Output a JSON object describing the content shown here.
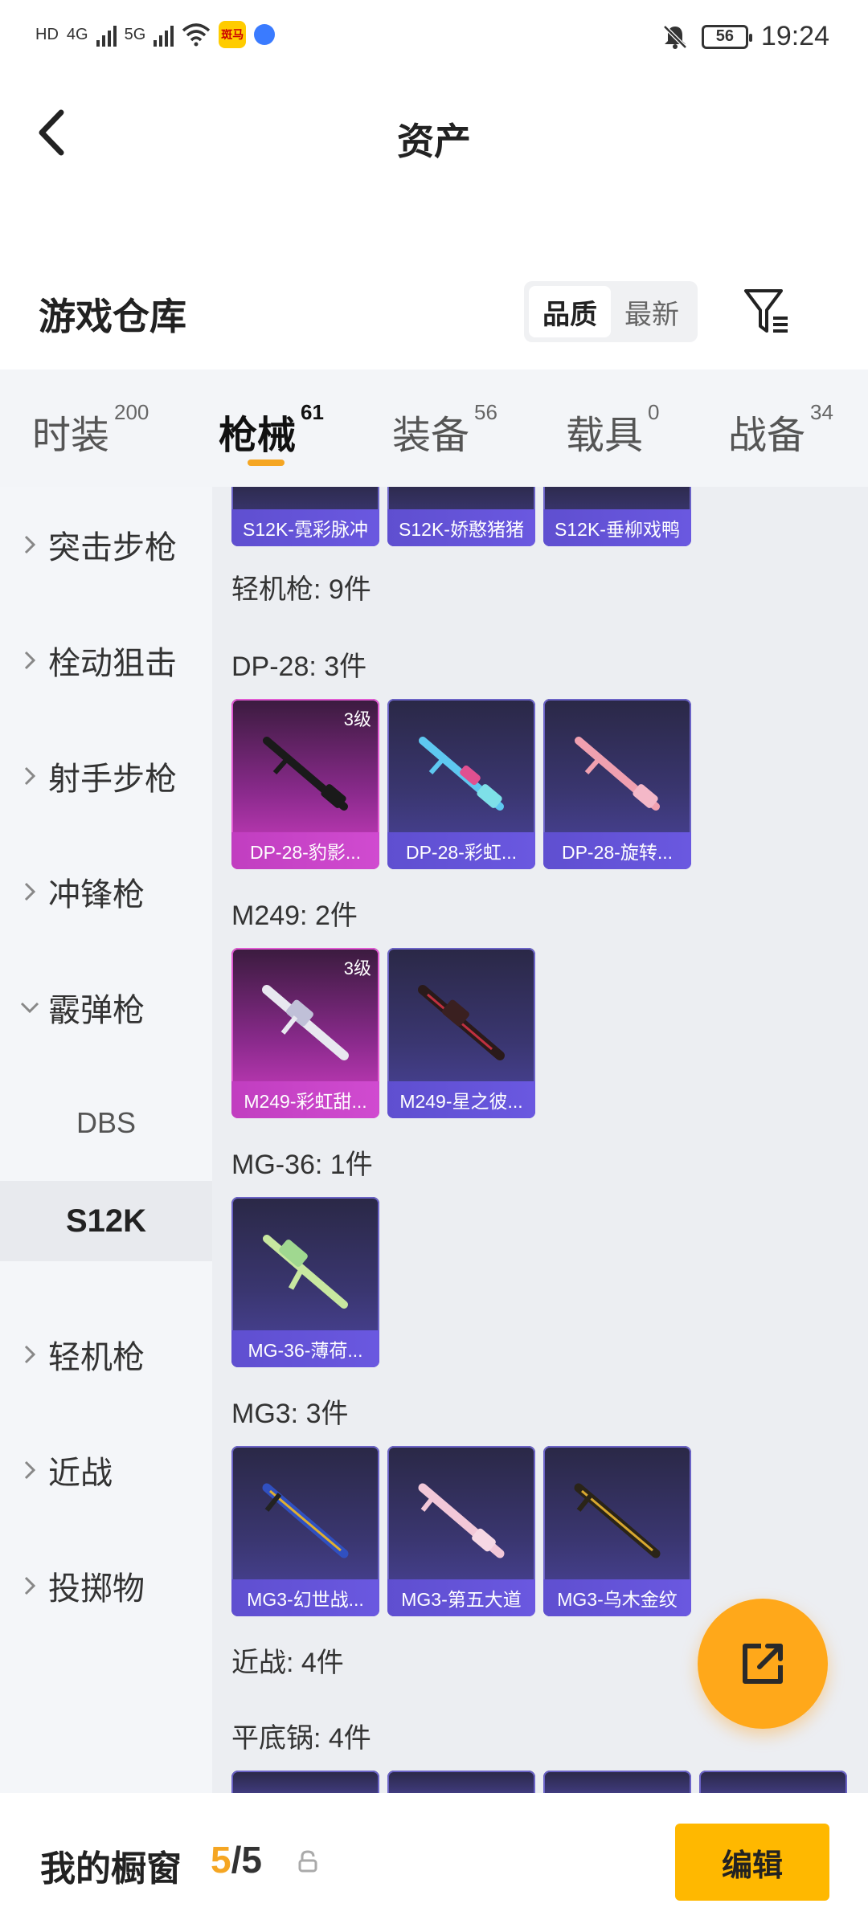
{
  "status_bar": {
    "left_text_1": "HD",
    "left_text_2": "4G",
    "left_text_3": "5G",
    "app_badge": "斑马",
    "battery": "56",
    "time": "19:24"
  },
  "header": {
    "title": "资产"
  },
  "warehouse": {
    "title": "游戏仓库",
    "sort_options": [
      "品质",
      "最新"
    ],
    "selected_sort": "品质"
  },
  "tabs": [
    {
      "label": "时装",
      "count": "200"
    },
    {
      "label": "枪械",
      "count": "61"
    },
    {
      "label": "装备",
      "count": "56"
    },
    {
      "label": "载具",
      "count": "0"
    },
    {
      "label": "战备",
      "count": "34"
    }
  ],
  "active_tab": "枪械",
  "sidebar": {
    "items": [
      {
        "label": "突击步枪"
      },
      {
        "label": "栓动狙击"
      },
      {
        "label": "射手步枪"
      },
      {
        "label": "冲锋枪"
      },
      {
        "label": "霰弹枪"
      }
    ],
    "sub_items": [
      {
        "label": "DBS"
      },
      {
        "label": "S12K"
      }
    ],
    "items_after": [
      {
        "label": "轻机枪"
      },
      {
        "label": "近战"
      },
      {
        "label": "投掷物"
      }
    ]
  },
  "content": {
    "top_cards": [
      "S12K-霓彩脉冲",
      "S12K-娇憨猪猪",
      "S12K-垂柳戏鸭"
    ],
    "category_label": "轻机枪: 9件",
    "groups": [
      {
        "label": "DP-28: 3件",
        "cards": [
          {
            "name": "DP-28-豹影...",
            "level": "3级",
            "rarity": "pink"
          },
          {
            "name": "DP-28-彩虹...",
            "level": "",
            "rarity": "purple"
          },
          {
            "name": "DP-28-旋转...",
            "level": "",
            "rarity": "purple"
          }
        ]
      },
      {
        "label": "M249: 2件",
        "cards": [
          {
            "name": "M249-彩虹甜...",
            "level": "3级",
            "rarity": "pink"
          },
          {
            "name": "M249-星之彼...",
            "level": "",
            "rarity": "purple"
          }
        ]
      },
      {
        "label": "MG-36: 1件",
        "cards": [
          {
            "name": "MG-36-薄荷...",
            "level": "",
            "rarity": "purple"
          }
        ]
      },
      {
        "label": "MG3: 3件",
        "cards": [
          {
            "name": "MG3-幻世战...",
            "level": "",
            "rarity": "purple"
          },
          {
            "name": "MG3-第五大道",
            "level": "",
            "rarity": "purple"
          },
          {
            "name": "MG3-乌木金纹",
            "level": "",
            "rarity": "purple"
          }
        ]
      }
    ],
    "melee_label": "近战: 4件",
    "pan_label": "平底锅: 4件"
  },
  "bottom_bar": {
    "title": "我的橱窗",
    "current": "5",
    "separator": "/",
    "total": "5",
    "edit_label": "编辑"
  },
  "colors": {
    "accent": "#f5a623",
    "edit_button": "#ffb800",
    "fab": "#ffa81a"
  }
}
